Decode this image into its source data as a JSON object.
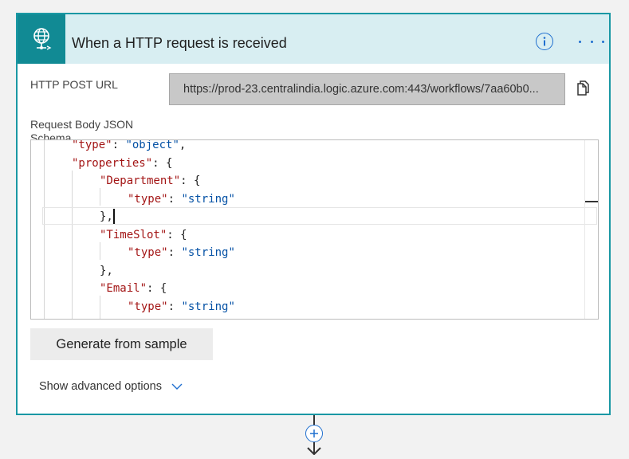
{
  "card": {
    "title": "When a HTTP request is received",
    "icon": "http-request-globe-icon",
    "accent_color": "#118a94",
    "header_bg": "#d8eef2"
  },
  "http_post_url": {
    "label": "HTTP POST URL",
    "value": "https://prod-23.centralindia.logic.azure.com:443/workflows/7aa60b0..."
  },
  "schema": {
    "label": "Request Body JSON Schema",
    "code_lines": [
      {
        "indent": 1,
        "tokens": [
          {
            "t": "\"type\"",
            "c": "k"
          },
          {
            "t": ": ",
            "c": "p"
          },
          {
            "t": "\"object\"",
            "c": "s"
          },
          {
            "t": ",",
            "c": "p"
          }
        ]
      },
      {
        "indent": 1,
        "tokens": [
          {
            "t": "\"properties\"",
            "c": "k"
          },
          {
            "t": ": {",
            "c": "p"
          }
        ]
      },
      {
        "indent": 2,
        "tokens": [
          {
            "t": "\"Department\"",
            "c": "k"
          },
          {
            "t": ": {",
            "c": "p"
          }
        ]
      },
      {
        "indent": 3,
        "tokens": [
          {
            "t": "\"type\"",
            "c": "k"
          },
          {
            "t": ": ",
            "c": "p"
          },
          {
            "t": "\"string\"",
            "c": "s"
          }
        ]
      },
      {
        "indent": 2,
        "tokens": [
          {
            "t": "},",
            "c": "p"
          }
        ]
      },
      {
        "indent": 2,
        "tokens": [
          {
            "t": "\"TimeSlot\"",
            "c": "k"
          },
          {
            "t": ": {",
            "c": "p"
          }
        ]
      },
      {
        "indent": 3,
        "tokens": [
          {
            "t": "\"type\"",
            "c": "k"
          },
          {
            "t": ": ",
            "c": "p"
          },
          {
            "t": "\"string\"",
            "c": "s"
          }
        ]
      },
      {
        "indent": 2,
        "tokens": [
          {
            "t": "},",
            "c": "p"
          }
        ]
      },
      {
        "indent": 2,
        "tokens": [
          {
            "t": "\"Email\"",
            "c": "k"
          },
          {
            "t": ": {",
            "c": "p"
          }
        ]
      },
      {
        "indent": 3,
        "tokens": [
          {
            "t": "\"type\"",
            "c": "k"
          },
          {
            "t": ": ",
            "c": "p"
          },
          {
            "t": "\"string\"",
            "c": "s"
          }
        ]
      }
    ]
  },
  "buttons": {
    "generate": "Generate from sample",
    "advanced": "Show advanced options"
  },
  "icons": {
    "info": "info-icon",
    "more": "more-options-icon",
    "copy": "copy-icon",
    "chevron": "chevron-down-icon",
    "add": "add-step-icon",
    "arrow": "arrow-down-icon"
  }
}
